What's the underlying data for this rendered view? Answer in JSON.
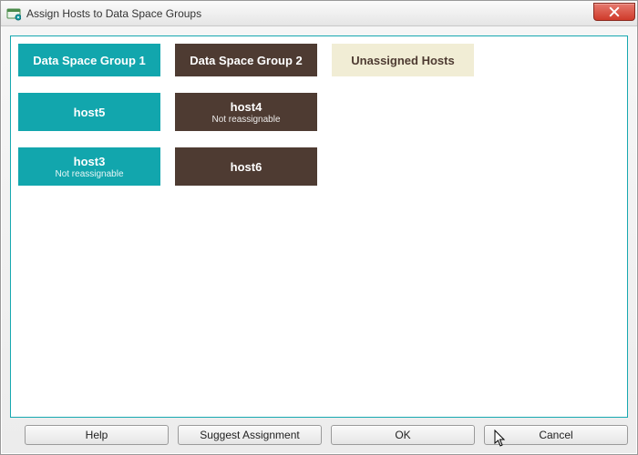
{
  "window": {
    "title": "Assign Hosts to Data Space Groups"
  },
  "columns": [
    {
      "header": "Data Space Group 1",
      "headerClass": "teal",
      "hosts": [
        {
          "name": "host5",
          "sub": "",
          "class": "teal"
        },
        {
          "name": "host3",
          "sub": "Not reassignable",
          "class": "teal"
        }
      ]
    },
    {
      "header": "Data Space Group 2",
      "headerClass": "brown",
      "hosts": [
        {
          "name": "host4",
          "sub": "Not reassignable",
          "class": "brown"
        },
        {
          "name": "host6",
          "sub": "",
          "class": "brown"
        }
      ]
    },
    {
      "header": "Unassigned Hosts",
      "headerClass": "tan",
      "hosts": []
    }
  ],
  "buttons": {
    "help": "Help",
    "suggest": "Suggest Assignment",
    "ok": "OK",
    "cancel": "Cancel"
  }
}
